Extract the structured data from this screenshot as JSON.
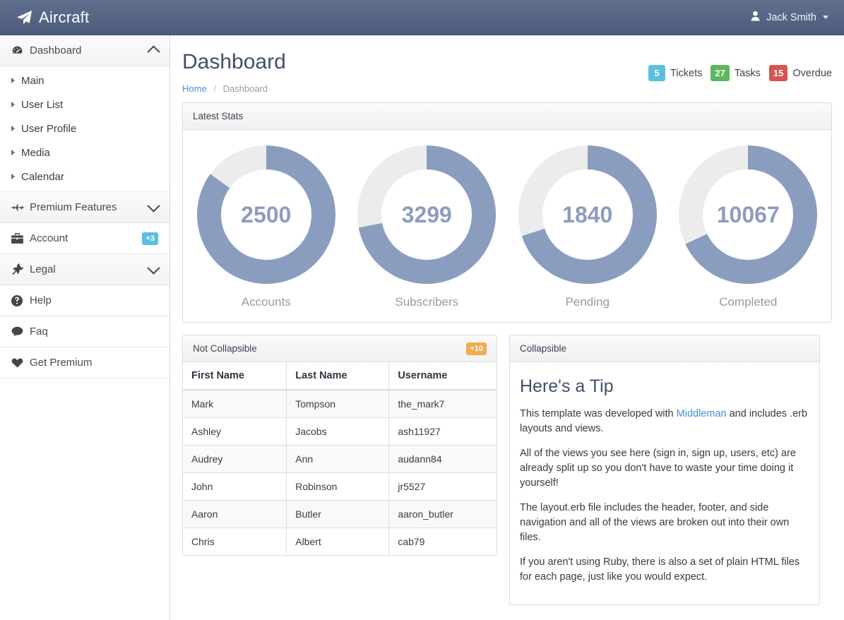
{
  "navbar": {
    "brand": "Aircraft",
    "brand_icon": "paper-plane-icon",
    "user_name": "Jack Smith",
    "user_icon": "user-icon",
    "caret_icon": "caret-down-icon",
    "bg_color": "#5a6a88"
  },
  "sidebar": {
    "dashboard": {
      "label": "Dashboard",
      "icon": "tachometer-icon",
      "chevron": "chevron-up-icon"
    },
    "sub_items": [
      {
        "label": "Main",
        "icon": "caret-right-icon"
      },
      {
        "label": "User List",
        "icon": "caret-right-icon"
      },
      {
        "label": "User Profile",
        "icon": "caret-right-icon"
      },
      {
        "label": "Media",
        "icon": "caret-right-icon"
      },
      {
        "label": "Calendar",
        "icon": "caret-right-icon"
      }
    ],
    "items": [
      {
        "label": "Premium Features",
        "icon": "fighter-jet-icon",
        "chevron": "chevron-down-icon",
        "badge": null,
        "header": true
      },
      {
        "label": "Account",
        "icon": "briefcase-icon",
        "chevron": null,
        "badge": "+3",
        "badge_color": "#5bc0de",
        "header": false
      },
      {
        "label": "Legal",
        "icon": "gavel-icon",
        "chevron": "chevron-down-icon",
        "badge": null,
        "header": true
      },
      {
        "label": "Help",
        "icon": "question-circle-icon",
        "chevron": null,
        "badge": null,
        "header": false
      },
      {
        "label": "Faq",
        "icon": "comment-icon",
        "chevron": null,
        "badge": null,
        "header": false
      },
      {
        "label": "Get Premium",
        "icon": "heart-icon",
        "chevron": null,
        "badge": null,
        "header": false
      }
    ]
  },
  "page": {
    "title": "Dashboard",
    "breadcrumb": {
      "home": "Home",
      "separator": "/",
      "current": "Dashboard"
    },
    "stats": [
      {
        "count": "5",
        "label": "Tickets",
        "color": "#5bc0de"
      },
      {
        "count": "27",
        "label": "Tasks",
        "color": "#5cb85c"
      },
      {
        "count": "15",
        "label": "Overdue",
        "color": "#d9534f"
      }
    ]
  },
  "stats_panel": {
    "title": "Latest Stats"
  },
  "chart_data": [
    {
      "type": "pie",
      "title": "Accounts",
      "value": 2500,
      "percent": 85,
      "fill_color": "#8b9dbf",
      "track_color": "#ececec"
    },
    {
      "type": "pie",
      "title": "Subscribers",
      "value": 3299,
      "percent": 72,
      "fill_color": "#8b9dbf",
      "track_color": "#ececec"
    },
    {
      "type": "pie",
      "title": "Pending",
      "value": 1840,
      "percent": 70,
      "fill_color": "#8b9dbf",
      "track_color": "#ececec"
    },
    {
      "type": "pie",
      "title": "Completed",
      "value": 10067,
      "percent": 68,
      "fill_color": "#8b9dbf",
      "track_color": "#ececec"
    }
  ],
  "table_panel": {
    "title": "Not Collapsible",
    "badge": "+10",
    "badge_color": "#f0ad4e",
    "columns": [
      "First Name",
      "Last Name",
      "Username"
    ],
    "rows": [
      [
        "Mark",
        "Tompson",
        "the_mark7"
      ],
      [
        "Ashley",
        "Jacobs",
        "ash11927"
      ],
      [
        "Audrey",
        "Ann",
        "audann84"
      ],
      [
        "John",
        "Robinson",
        "jr5527"
      ],
      [
        "Aaron",
        "Butler",
        "aaron_butler"
      ],
      [
        "Chris",
        "Albert",
        "cab79"
      ]
    ]
  },
  "tip_panel": {
    "title": "Collapsible",
    "heading": "Here's a Tip",
    "p1_before": "This template was developed with ",
    "p1_link": "Middleman",
    "p1_after": " and includes .erb layouts and views.",
    "p2": "All of the views you see here (sign in, sign up, users, etc) are already split up so you don't have to waste your time doing it yourself!",
    "p3": "The layout.erb file includes the header, footer, and side navigation and all of the views are broken out into their own files.",
    "p4": "If you aren't using Ruby, there is also a set of plain HTML files for each page, just like you would expect."
  }
}
